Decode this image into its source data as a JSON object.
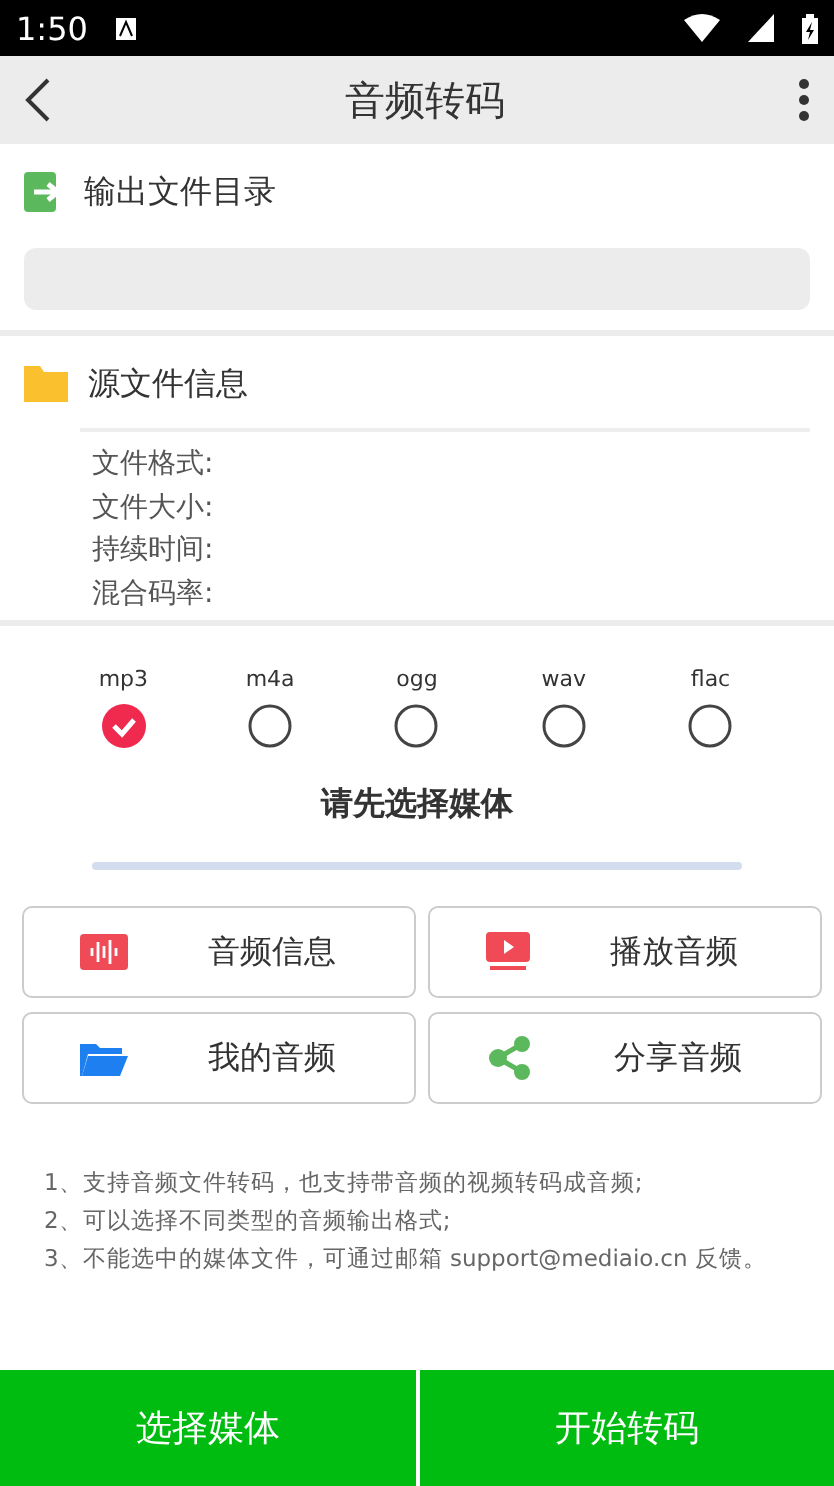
{
  "status_bar": {
    "time": "1:50"
  },
  "toolbar": {
    "title": "音频转码"
  },
  "output_dir": {
    "title": "输出文件目录"
  },
  "source_info": {
    "title": "源文件信息",
    "fields": [
      "文件格式:",
      "文件大小:",
      "持续时间:",
      "混合码率:"
    ]
  },
  "formats": [
    {
      "label": "mp3",
      "selected": true
    },
    {
      "label": "m4a",
      "selected": false
    },
    {
      "label": "ogg",
      "selected": false
    },
    {
      "label": "wav",
      "selected": false
    },
    {
      "label": "flac",
      "selected": false
    }
  ],
  "status_text": "请先选择媒体",
  "progress": {
    "level": 0
  },
  "actions": [
    {
      "kind": "info",
      "label": "音频信息"
    },
    {
      "kind": "play",
      "label": "播放音频"
    },
    {
      "kind": "folder",
      "label": "我的音频"
    },
    {
      "kind": "share",
      "label": "分享音频"
    }
  ],
  "notes": [
    "1、支持音频文件转码，也支持带音频的视频转码成音频;",
    "2、可以选择不同类型的音频输出格式;",
    "3、不能选中的媒体文件，可通过邮箱 support@mediaio.cn 反馈。"
  ],
  "bottom_buttons": [
    "选择媒体",
    "开始转码"
  ]
}
